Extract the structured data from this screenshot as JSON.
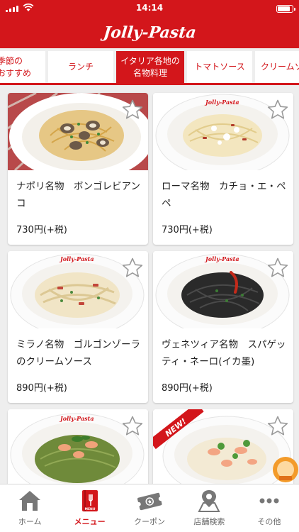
{
  "status_bar": {
    "time": "14:14"
  },
  "header": {
    "logo_text": "Jolly-Pasta"
  },
  "category_tabs": [
    {
      "label_line1": "季節の",
      "label_line2": "おすすめ",
      "active": false
    },
    {
      "label_line1": "ランチ",
      "label_line2": "",
      "active": false
    },
    {
      "label_line1": "イタリア各地の",
      "label_line2": "名物料理",
      "active": true
    },
    {
      "label_line1": "トマトソース",
      "label_line2": "",
      "active": false
    },
    {
      "label_line1": "クリームソ",
      "label_line2": "",
      "active": false
    }
  ],
  "menu_items": [
    {
      "name": "ナポリ名物　ボンゴレビアンコ",
      "price": "730円(+税)",
      "badge": ""
    },
    {
      "name": "ローマ名物　カチョ・エ・ペペ",
      "price": "730円(+税)",
      "badge": ""
    },
    {
      "name": "ミラノ名物　ゴルゴンゾーラのクリームソース",
      "price": "890円(+税)",
      "badge": ""
    },
    {
      "name": "ヴェネツィア名物　スパゲッティ・ネーロ(イカ墨)",
      "price": "890円(+税)",
      "badge": ""
    },
    {
      "name": "",
      "price": "",
      "badge": ""
    },
    {
      "name": "",
      "price": "",
      "badge": "NEW!"
    }
  ],
  "plate_logo": "Jolly-Pasta",
  "bottom_nav": [
    {
      "label": "ホーム",
      "icon": "home-icon",
      "active": false
    },
    {
      "label": "メニュー",
      "icon": "menu-book-icon",
      "icon_text": "MENU",
      "active": true
    },
    {
      "label": "クーポン",
      "icon": "coupon-icon",
      "active": false
    },
    {
      "label": "店舗検索",
      "icon": "map-pin-icon",
      "active": false
    },
    {
      "label": "その他",
      "icon": "more-icon",
      "active": false
    }
  ],
  "colors": {
    "brand_red": "#d3161b",
    "background": "#eeeeee",
    "inactive_icon": "#777777"
  }
}
